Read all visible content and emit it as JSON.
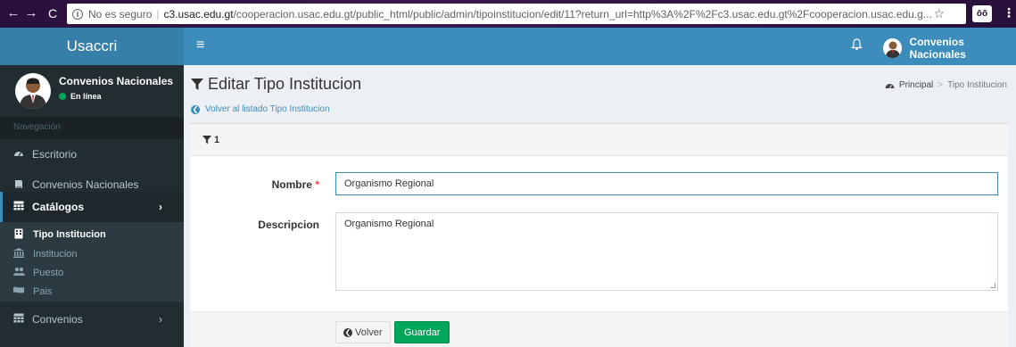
{
  "browser": {
    "back": "←",
    "forward": "→",
    "reload": "C",
    "info": "i",
    "insecure_label": "No es seguro",
    "separator": "|",
    "url_host": "c3.usac.edu.gt",
    "url_path": "/cooperacion.usac.edu.gt/public_html/public/admin/tipoinstitucion/edit/11?return_url=http%3A%2F%2Fc3.usac.edu.gt%2Fcooperacion.usac.edu.g...",
    "star": "☆",
    "ext_label": "ōō",
    "menu": "⋮"
  },
  "header": {
    "brand": "Usaccri",
    "hamburger": "≡",
    "bell": "🔔",
    "user_name": "Convenios Nacionales"
  },
  "sidebar": {
    "user_name": "Convenios Nacionales",
    "status": "En línea",
    "nav_header": "Navegación",
    "items": [
      {
        "label": "Escritorio",
        "icon": "dashboard-icon"
      },
      {
        "label": "Convenios Nacionales",
        "icon": "book-icon"
      },
      {
        "label": "Catálogos",
        "icon": "table-icon"
      },
      {
        "label": "Convenios",
        "icon": "table-icon"
      }
    ],
    "sub_items": [
      {
        "label": "Tipo Institucion",
        "icon": "building-icon"
      },
      {
        "label": "Institucion",
        "icon": "bank-icon"
      },
      {
        "label": "Puesto",
        "icon": "users-icon"
      },
      {
        "label": "Pais",
        "icon": "flag-icon"
      }
    ],
    "chevron": "›"
  },
  "page": {
    "title": "Editar Tipo Institucion",
    "breadcrumb_home": "Principal",
    "breadcrumb_sep": ">",
    "breadcrumb_current": "Tipo Institucion",
    "back_link": "Volver al listado Tipo Institucion",
    "back_icon": "❮"
  },
  "form": {
    "header_id": "1",
    "nombre_label": "Nombre",
    "required_mark": "*",
    "nombre_value": "Organismo Regional",
    "descripcion_label": "Descripcion",
    "descripcion_value": "Organismo Regional",
    "volver_label": "Volver",
    "guardar_label": "Guardar"
  },
  "colors": {
    "brand": "#367fa9",
    "topbar": "#3c8dbc",
    "sidebar": "#222d32",
    "success": "#00a65a"
  }
}
